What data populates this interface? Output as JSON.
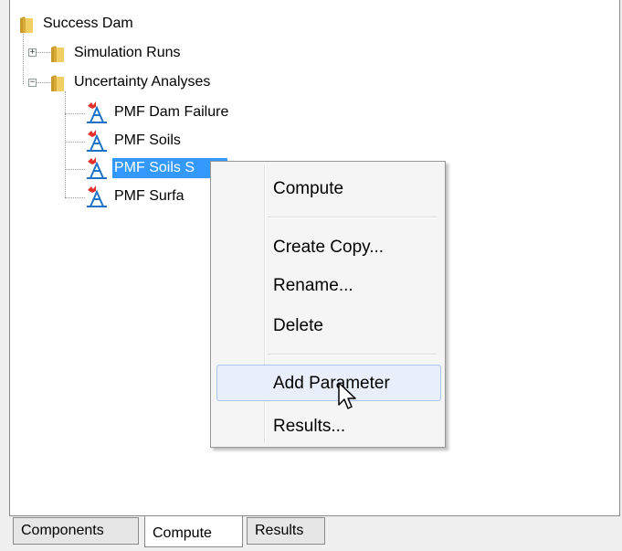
{
  "tree": {
    "root": "Success Dam",
    "folders": [
      {
        "label": "Simulation Runs",
        "expander": "+"
      },
      {
        "label": "Uncertainty Analyses",
        "expander": "−"
      }
    ],
    "items": [
      {
        "label": "PMF Dam Failure"
      },
      {
        "label": "PMF Soils"
      },
      {
        "label": "PMF Soils S"
      },
      {
        "label": "PMF Surfa"
      }
    ]
  },
  "context_menu": {
    "items": [
      {
        "label": "Compute"
      },
      {
        "label": "Create Copy..."
      },
      {
        "label": "Rename..."
      },
      {
        "label": "Delete"
      },
      {
        "label": "Add Parameter"
      },
      {
        "label": "Results..."
      }
    ]
  },
  "tabs": [
    {
      "label": "Components"
    },
    {
      "label": "Compute"
    },
    {
      "label": "Results"
    }
  ],
  "colors": {
    "selection": "#3399ff",
    "menu_highlight": "#e8effa",
    "folder": "#e8c25a"
  },
  "icons": {
    "folder": "folder-icon",
    "analysis": "uncertainty-analysis-icon",
    "cursor": "mouse-pointer-icon"
  }
}
